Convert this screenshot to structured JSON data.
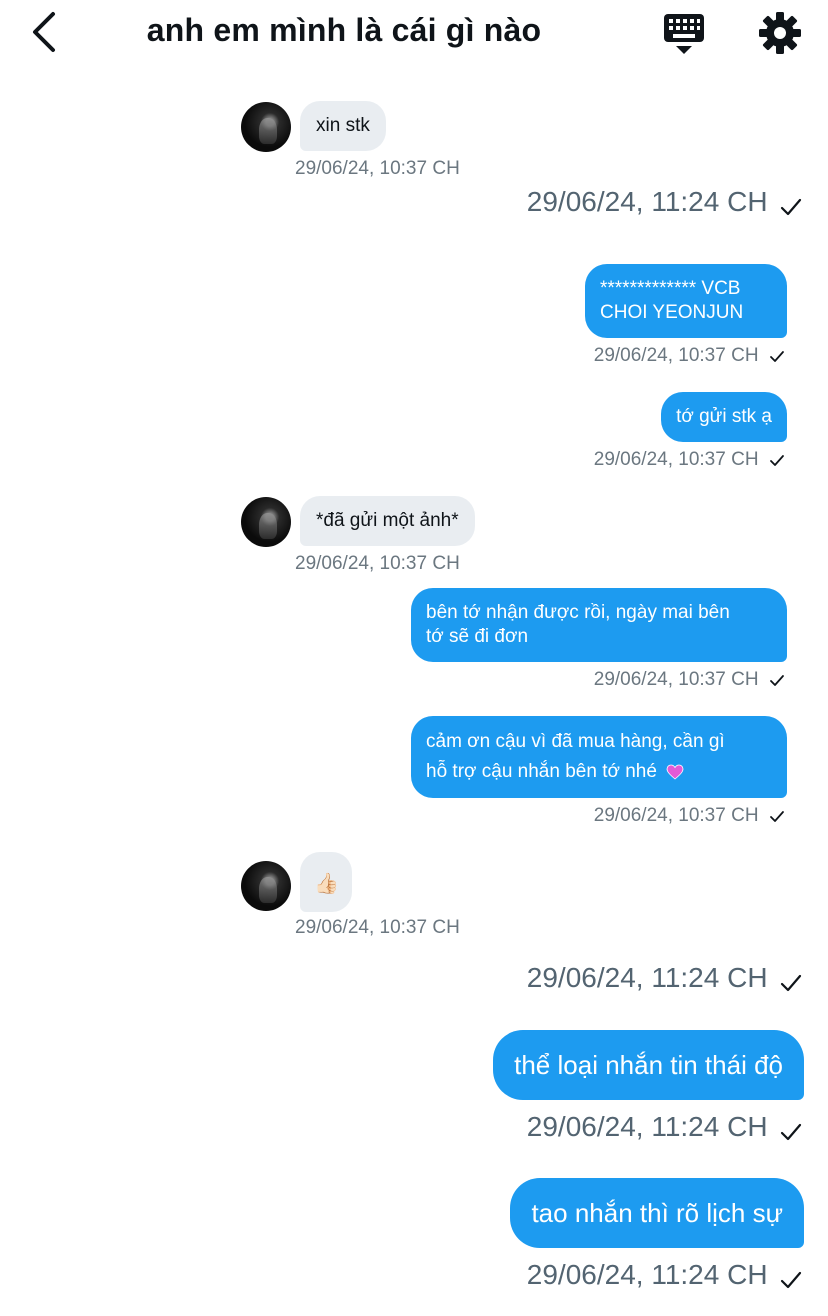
{
  "header": {
    "title": "anh em mình là cái gì nào",
    "back_icon": "chevron-left-icon",
    "keyboard_icon": "keyboard-icon",
    "settings_icon": "gear-icon"
  },
  "colors": {
    "accent": "#1d9bf0",
    "incoming_bubble": "#e9edf1",
    "timestamp": "#536471"
  },
  "messages": [
    {
      "type": "received",
      "text": "xin stk",
      "time": "29/06/24, 10:37 CH"
    },
    {
      "type": "divider",
      "time": "29/06/24, 11:24 CH"
    },
    {
      "type": "sent",
      "line1": "************* VCB",
      "line2": "CHOI YEONJUN",
      "time": "29/06/24, 10:37 CH"
    },
    {
      "type": "sent",
      "text": "tớ gửi stk ạ",
      "time": "29/06/24, 10:37 CH"
    },
    {
      "type": "received",
      "text": "*đã gửi một ảnh*",
      "time": "29/06/24, 10:37 CH"
    },
    {
      "type": "sent",
      "line1": "bên tớ nhận được rồi, ngày mai bên",
      "line2": "tớ sẽ đi đơn",
      "time": "29/06/24, 10:37 CH"
    },
    {
      "type": "sent",
      "line1": "cảm ơn cậu vì đã mua hàng, cần gì",
      "line2": "hỗ trợ cậu nhắn bên tớ nhé",
      "line2_emoji": "heart-icon",
      "time": "29/06/24, 10:37 CH"
    },
    {
      "type": "received",
      "emoji": "👍🏻",
      "time": "29/06/24, 10:37 CH"
    },
    {
      "type": "divider",
      "time": "29/06/24, 11:24 CH"
    },
    {
      "type": "sent_big",
      "text": "thể loại nhắn tin thái độ",
      "time": "29/06/24, 11:24 CH"
    },
    {
      "type": "sent_big",
      "text": "tao nhắn thì rõ lịch sự",
      "time": "29/06/24, 11:24 CH"
    }
  ]
}
